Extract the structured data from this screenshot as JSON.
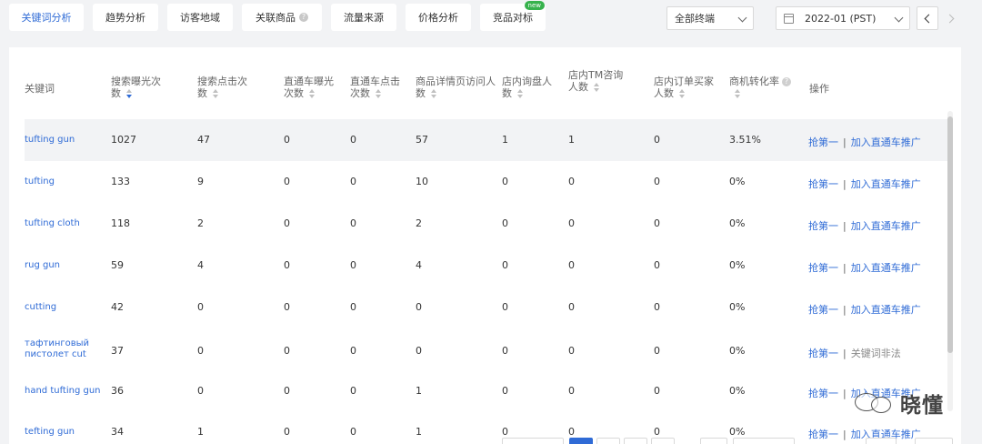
{
  "tabs": [
    {
      "label": "关键词分析",
      "active": true
    },
    {
      "label": "趋势分析"
    },
    {
      "label": "访客地域"
    },
    {
      "label": "关联商品"
    },
    {
      "label": "流量来源"
    },
    {
      "label": "价格分析"
    },
    {
      "label": "竞品对标",
      "badge": "new"
    }
  ],
  "filters": {
    "device": "全部终端",
    "date": "2022-01 (PST)"
  },
  "table": {
    "headers": {
      "keyword": "关键词",
      "search_exposure": "搜索曝光次数",
      "search_clicks": "搜索点击次数",
      "ztc_exposure": "直通车曝光次数",
      "ztc_clicks": "直通车点击次数",
      "detail_visitors": "商品详情页访问人数",
      "store_inquiry": "店内询盘人数",
      "store_tm": "店内TM咨询人数",
      "store_order": "店内订单买家人数",
      "conversion": "商机转化率",
      "actions": "操作"
    },
    "rows": [
      {
        "keyword": "tufting gun",
        "search_exposure": "1027",
        "search_clicks": "47",
        "ztc_exposure": "0",
        "ztc_clicks": "0",
        "detail_visitors": "57",
        "store_inquiry": "1",
        "store_tm": "1",
        "store_order": "0",
        "conversion": "3.51%",
        "action1": "抢第一",
        "action2": "加入直通车推广"
      },
      {
        "keyword": "tufting",
        "search_exposure": "133",
        "search_clicks": "9",
        "ztc_exposure": "0",
        "ztc_clicks": "0",
        "detail_visitors": "10",
        "store_inquiry": "0",
        "store_tm": "0",
        "store_order": "0",
        "conversion": "0%",
        "action1": "抢第一",
        "action2": "加入直通车推广"
      },
      {
        "keyword": "tufting cloth",
        "search_exposure": "118",
        "search_clicks": "2",
        "ztc_exposure": "0",
        "ztc_clicks": "0",
        "detail_visitors": "2",
        "store_inquiry": "0",
        "store_tm": "0",
        "store_order": "0",
        "conversion": "0%",
        "action1": "抢第一",
        "action2": "加入直通车推广"
      },
      {
        "keyword": "rug gun",
        "search_exposure": "59",
        "search_clicks": "4",
        "ztc_exposure": "0",
        "ztc_clicks": "0",
        "detail_visitors": "4",
        "store_inquiry": "0",
        "store_tm": "0",
        "store_order": "0",
        "conversion": "0%",
        "action1": "抢第一",
        "action2": "加入直通车推广"
      },
      {
        "keyword": "cutting",
        "search_exposure": "42",
        "search_clicks": "0",
        "ztc_exposure": "0",
        "ztc_clicks": "0",
        "detail_visitors": "0",
        "store_inquiry": "0",
        "store_tm": "0",
        "store_order": "0",
        "conversion": "0%",
        "action1": "抢第一",
        "action2": "加入直通车推广"
      },
      {
        "keyword": "тафтинговый пистолет cut",
        "search_exposure": "37",
        "search_clicks": "0",
        "ztc_exposure": "0",
        "ztc_clicks": "0",
        "detail_visitors": "0",
        "store_inquiry": "0",
        "store_tm": "0",
        "store_order": "0",
        "conversion": "0%",
        "action1": "抢第一",
        "action2": "关键词非法"
      },
      {
        "keyword": "hand tufting gun",
        "search_exposure": "36",
        "search_clicks": "0",
        "ztc_exposure": "0",
        "ztc_clicks": "0",
        "detail_visitors": "1",
        "store_inquiry": "0",
        "store_tm": "0",
        "store_order": "0",
        "conversion": "0%",
        "action1": "抢第一",
        "action2": "加入直通车推广"
      },
      {
        "keyword": "tefting gun",
        "search_exposure": "34",
        "search_clicks": "1",
        "ztc_exposure": "0",
        "ztc_clicks": "0",
        "detail_visitors": "1",
        "store_inquiry": "0",
        "store_tm": "0",
        "store_order": "0",
        "conversion": "0%",
        "action1": "抢第一",
        "action2": "加入直通车推广"
      }
    ]
  },
  "watermark": {
    "text": "晓懂"
  },
  "colors": {
    "accent": "#2f6bd6",
    "badge": "#37b24d",
    "background": "#f2f3f5"
  }
}
